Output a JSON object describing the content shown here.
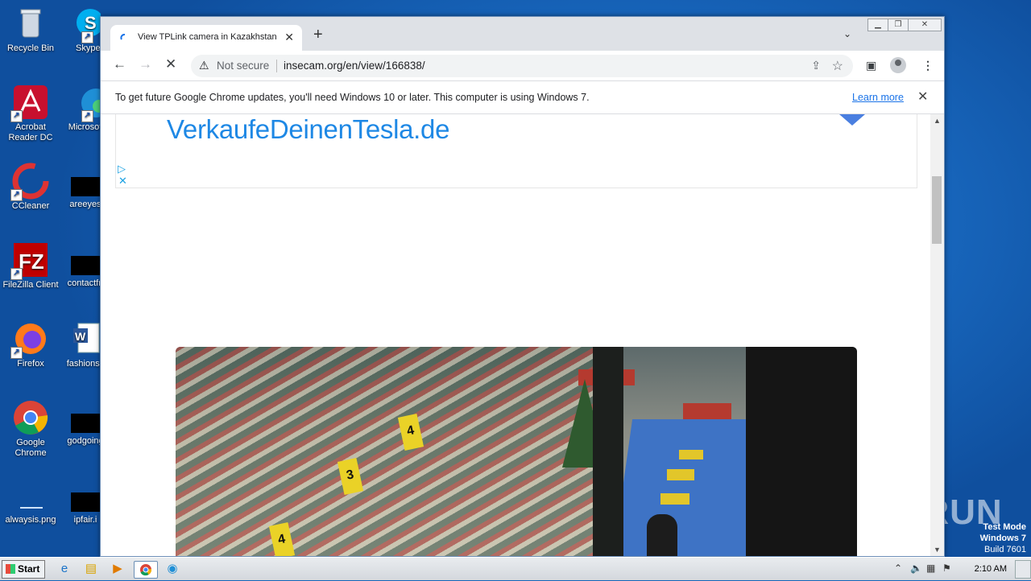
{
  "desktop": {
    "icons_left": [
      {
        "label": "Recycle Bin",
        "icon": "recycle-bin-icon"
      },
      {
        "label": "Acrobat\nReader DC",
        "icon": "acrobat-icon"
      },
      {
        "label": "CCleaner",
        "icon": "ccleaner-icon"
      },
      {
        "label": "FileZilla Client",
        "icon": "filezilla-icon"
      },
      {
        "label": "Firefox",
        "icon": "firefox-icon"
      },
      {
        "label": "Google\nChrome",
        "icon": "chrome-icon"
      },
      {
        "label": "alwaysis.png",
        "icon": "image-file-icon"
      }
    ],
    "icons_right": [
      {
        "label": "Skype",
        "icon": "skype-icon"
      },
      {
        "label": "Microsoft",
        "icon": "edge-icon"
      },
      {
        "label": "areeyes",
        "icon": "file-icon"
      },
      {
        "label": "contactfri",
        "icon": "file-icon"
      },
      {
        "label": "fashionsy",
        "icon": "word-document-icon"
      },
      {
        "label": "godgoing",
        "icon": "file-icon"
      },
      {
        "label": "ipfair.i",
        "icon": "file-icon"
      }
    ],
    "watermark": "ANY RUN",
    "test_mode": {
      "line1": "Test Mode",
      "line2": "Windows 7",
      "line3": "Build 7601"
    }
  },
  "browser": {
    "tab_title": "View TPLink camera in Kazakhstan, U",
    "new_tab_symbol": "+",
    "security_label": "Not secure",
    "url": "insecam.org/en/view/166838/",
    "infobar": {
      "message": "To get future Google Chrome updates, you'll need Windows 10 or later. This computer is using Windows 7.",
      "link": "Learn more"
    },
    "ad": {
      "text": "VerkaufeDeinenTesla.de"
    }
  },
  "taskbar": {
    "start_label": "Start",
    "clock": "2:10 AM"
  }
}
